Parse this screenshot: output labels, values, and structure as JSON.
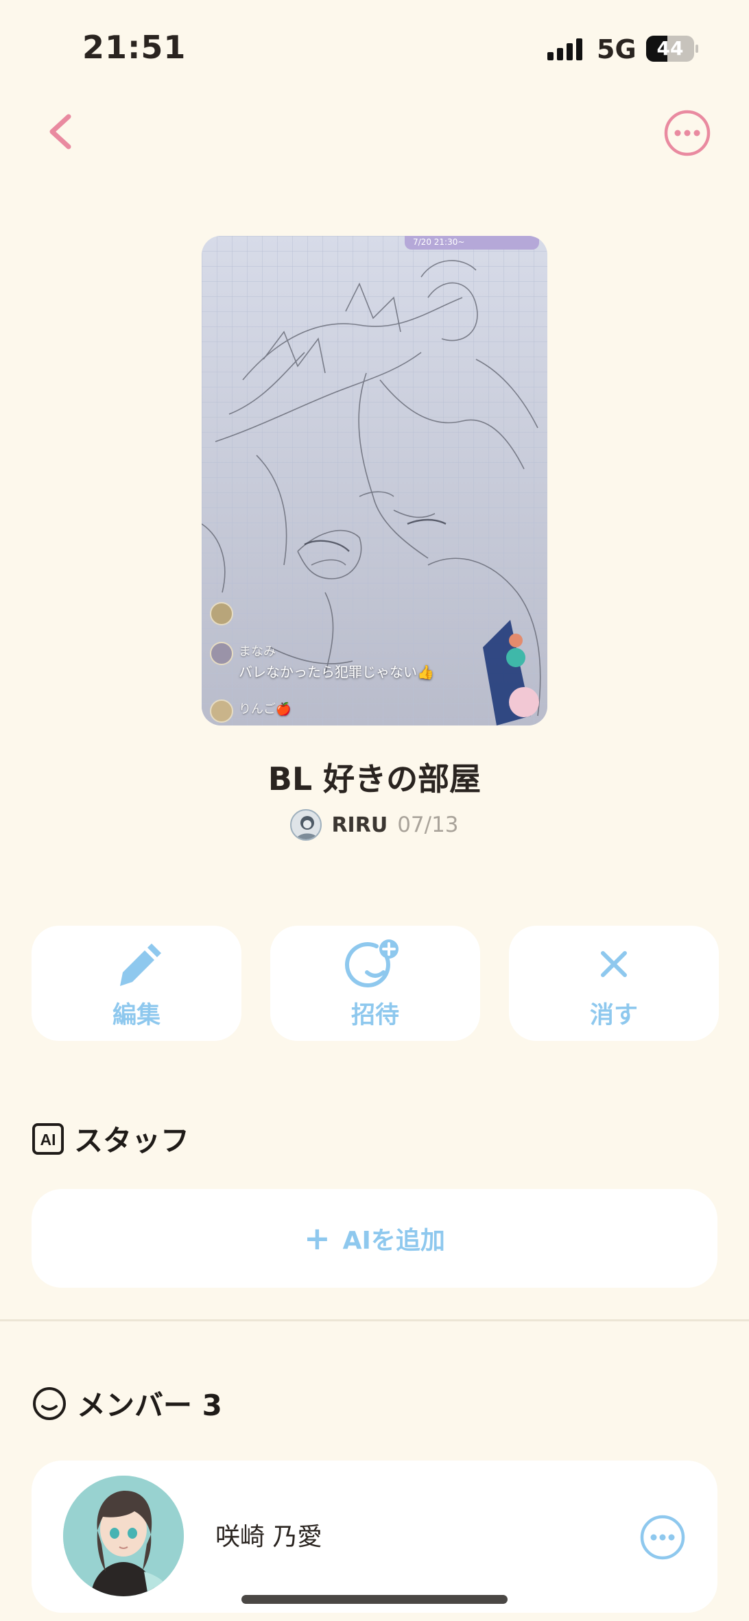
{
  "status_bar": {
    "time": "21:51",
    "network": "5G",
    "battery_level": "44"
  },
  "nav": {
    "back_icon": "chevron-left-icon",
    "more_icon": "more-horizontal-circle-icon",
    "accent_color": "#e98aa0"
  },
  "cover": {
    "banner_text": "7/20 21:30~",
    "chat": [
      {
        "name": "まなみ",
        "message": "バレなかったら犯罪じゃない👍"
      },
      {
        "name": "りんご🍎",
        "message": ""
      }
    ]
  },
  "room": {
    "title": "BL 好きの部屋",
    "owner_name": "RIRU",
    "created_date": "07/13"
  },
  "actions": [
    {
      "label": "編集",
      "icon": "pencil-icon"
    },
    {
      "label": "招待",
      "icon": "invite-face-plus-icon"
    },
    {
      "label": "消す",
      "icon": "close-x-icon"
    }
  ],
  "staff_section": {
    "title": "スタッフ",
    "icon": "ai-badge-icon",
    "add_label": "AIを追加"
  },
  "members_section": {
    "title": "メンバー 3",
    "icon": "smile-face-icon",
    "members": [
      {
        "name": "咲崎 乃愛"
      }
    ]
  },
  "colors": {
    "background": "#fdf8ec",
    "action_blue": "#8ec8ee",
    "card": "#ffffff"
  }
}
